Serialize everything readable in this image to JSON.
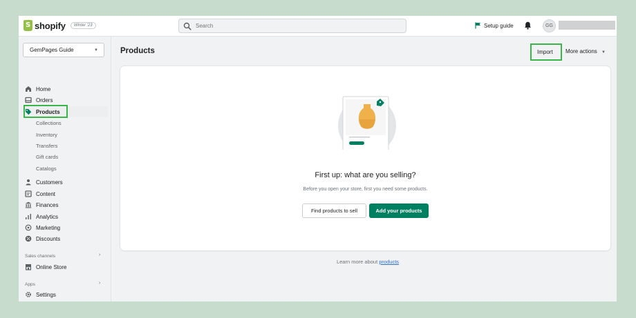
{
  "brand": {
    "name": "shopify",
    "edition": "Winter '23"
  },
  "search": {
    "placeholder": "Search"
  },
  "topbar": {
    "setup_guide": "Setup guide",
    "avatar_initials": "GG"
  },
  "sidebar": {
    "store_name": "GemPages Guide",
    "items": [
      {
        "label": "Home",
        "icon": "home-icon"
      },
      {
        "label": "Orders",
        "icon": "orders-icon"
      },
      {
        "label": "Products",
        "icon": "tag-icon",
        "active": true
      },
      {
        "label": "Customers",
        "icon": "person-icon"
      },
      {
        "label": "Content",
        "icon": "content-icon"
      },
      {
        "label": "Finances",
        "icon": "bank-icon"
      },
      {
        "label": "Analytics",
        "icon": "bar-chart-icon"
      },
      {
        "label": "Marketing",
        "icon": "target-icon"
      },
      {
        "label": "Discounts",
        "icon": "discount-icon"
      }
    ],
    "product_subitems": [
      "Collections",
      "Inventory",
      "Transfers",
      "Gift cards",
      "Catalogs"
    ],
    "sales_channels_label": "Sales channels",
    "online_store": "Online Store",
    "apps_label": "Apps",
    "settings": "Settings"
  },
  "page": {
    "title": "Products",
    "import_label": "Import",
    "more_actions_label": "More actions"
  },
  "empty_state": {
    "heading": "First up: what are you selling?",
    "text": "Before you open your store, first you need some products.",
    "secondary_button": "Find products to sell",
    "primary_button": "Add your products"
  },
  "footer": {
    "text": "Learn more about",
    "link": "products"
  },
  "colors": {
    "primary": "#008060",
    "highlight": "#3bb54a",
    "background": "#c7dccd"
  }
}
